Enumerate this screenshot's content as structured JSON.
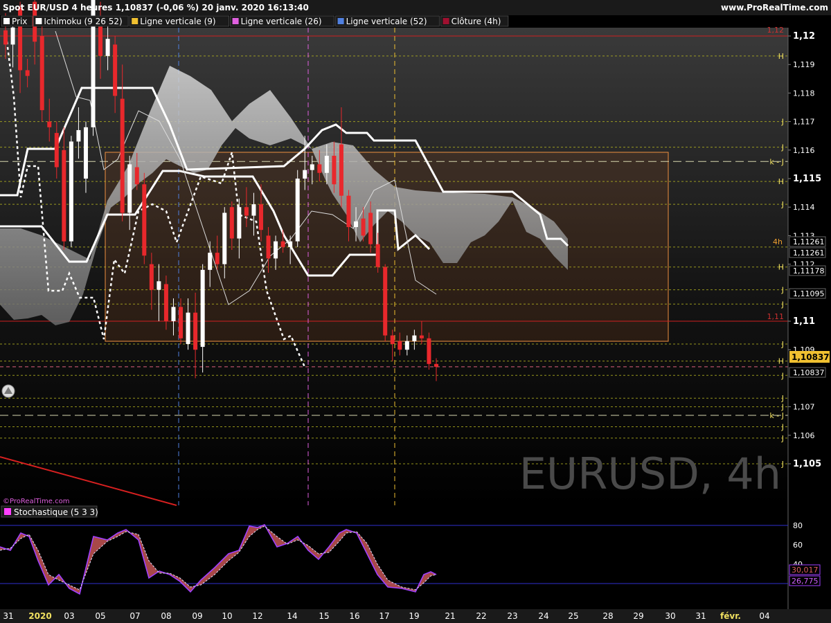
{
  "header": {
    "title": "Spot EUR/USD 4 heures 1,10837 (-0,06 %) 20 janv. 2020 16:13:40",
    "site": "www.ProRealTime.com"
  },
  "legend": [
    {
      "label": "Prix",
      "color": "#ffffff"
    },
    {
      "label": "Ichimoku (9 26 52)",
      "color": "#ffffff"
    },
    {
      "label": "Ligne verticale (9)",
      "color": "#f0c030"
    },
    {
      "label": "Ligne verticale (26)",
      "color": "#e060e0"
    },
    {
      "label": "Ligne verticale (52)",
      "color": "#5080e0"
    },
    {
      "label": "Clôture (4h)",
      "color": "#a01030"
    }
  ],
  "watermark": "EURUSD, 4h",
  "brand": "©ProRealTime.com",
  "stoch": {
    "label": "Stochastique (5 3 3)",
    "k_value": "30,017",
    "d_value": "26,775",
    "ticks": [
      "80",
      "60",
      "40"
    ]
  },
  "price_labels": {
    "last": "1,10837",
    "last2": "1,10837",
    "v1": "1,11261",
    "v2": "1,11261",
    "v3": "1,11178",
    "v4": "1,11095",
    "red_112": "1,12",
    "red_111": "1,11",
    "tf_4h": "4h"
  },
  "hj_markers": [
    {
      "y": 1.1193,
      "t": "H"
    },
    {
      "y": 1.117,
      "t": "J"
    },
    {
      "y": 1.1161,
      "t": "J"
    },
    {
      "y": 1.1156,
      "t": "k - J"
    },
    {
      "y": 1.1149,
      "t": "H"
    },
    {
      "y": 1.1141,
      "t": "J"
    },
    {
      "y": 1.1119,
      "t": "H"
    },
    {
      "y": 1.1111,
      "t": "J"
    },
    {
      "y": 1.1106,
      "t": "J"
    },
    {
      "y": 1.1092,
      "t": "J"
    },
    {
      "y": 1.1086,
      "t": "H"
    },
    {
      "y": 1.1081,
      "t": "J"
    },
    {
      "y": 1.1073,
      "t": "J"
    },
    {
      "y": 1.107,
      "t": "J"
    },
    {
      "y": 1.1067,
      "t": "k - J"
    },
    {
      "y": 1.1063,
      "t": "J"
    },
    {
      "y": 1.1059,
      "t": "J"
    },
    {
      "y": 1.105,
      "t": "J"
    }
  ],
  "colors": {
    "bull": "#ffffff",
    "bear": "#e8282c",
    "hline": "#b8b820",
    "stoch_k": "#a040ff",
    "stoch_fill": "#e06060"
  },
  "chart_data": {
    "type": "candlestick",
    "y_axis_ticks": [
      "1,12",
      "1,119",
      "1,118",
      "1,117",
      "1,116",
      "1,115",
      "1,114",
      "1,113",
      "1,112",
      "1,11",
      "1,109",
      "1,107",
      "1,106",
      "1,105"
    ],
    "ylim": [
      1.1035,
      1.1205
    ],
    "x_axis_labels": [
      "31",
      "2020",
      "03",
      "05",
      "07",
      "08",
      "09",
      "10",
      "12",
      "14",
      "15",
      "16",
      "17",
      "19",
      "21",
      "22",
      "23",
      "24",
      "25",
      "28",
      "29",
      "30",
      "31",
      "févr.",
      "04"
    ],
    "dotted_levels": [
      1.1193,
      1.117,
      1.1161,
      1.1149,
      1.1141,
      1.1126,
      1.1119,
      1.1111,
      1.1106,
      1.1092,
      1.1086,
      1.1081,
      1.1073,
      1.107,
      1.1063,
      1.1059,
      1.105
    ],
    "dashed_levels": [
      1.1156,
      1.1067
    ],
    "red_levels": [
      1.12,
      1.11
    ],
    "pink_dashed_level": 1.1084,
    "candles": [
      {
        "o": 1.1202,
        "h": 1.1208,
        "l": 1.1192,
        "c": 1.1197
      },
      {
        "o": 1.1197,
        "h": 1.1206,
        "l": 1.1189,
        "c": 1.1203
      },
      {
        "o": 1.121,
        "h": 1.1212,
        "l": 1.118,
        "c": 1.1188
      },
      {
        "o": 1.1188,
        "h": 1.1192,
        "l": 1.1182,
        "c": 1.1186
      },
      {
        "o": 1.1212,
        "h": 1.1215,
        "l": 1.119,
        "c": 1.1198
      },
      {
        "o": 1.12,
        "h": 1.1205,
        "l": 1.117,
        "c": 1.1174
      },
      {
        "o": 1.117,
        "h": 1.1178,
        "l": 1.1163,
        "c": 1.1168
      },
      {
        "o": 1.1166,
        "h": 1.117,
        "l": 1.115,
        "c": 1.1154
      },
      {
        "o": 1.116,
        "h": 1.1168,
        "l": 1.1125,
        "c": 1.1128
      },
      {
        "o": 1.1128,
        "h": 1.1165,
        "l": 1.1126,
        "c": 1.1163
      },
      {
        "o": 1.1163,
        "h": 1.1175,
        "l": 1.1157,
        "c": 1.1167
      },
      {
        "o": 1.115,
        "h": 1.117,
        "l": 1.1145,
        "c": 1.1168
      },
      {
        "o": 1.1168,
        "h": 1.1222,
        "l": 1.1165,
        "c": 1.1215
      },
      {
        "o": 1.1205,
        "h": 1.1212,
        "l": 1.1185,
        "c": 1.1193
      },
      {
        "o": 1.1193,
        "h": 1.1205,
        "l": 1.1188,
        "c": 1.1199
      },
      {
        "o": 1.1197,
        "h": 1.12,
        "l": 1.1173,
        "c": 1.1179
      },
      {
        "o": 1.1178,
        "h": 1.119,
        "l": 1.1135,
        "c": 1.1138
      },
      {
        "o": 1.1138,
        "h": 1.1158,
        "l": 1.1132,
        "c": 1.1155
      },
      {
        "o": 1.1154,
        "h": 1.1159,
        "l": 1.1146,
        "c": 1.1148
      },
      {
        "o": 1.1148,
        "h": 1.1152,
        "l": 1.112,
        "c": 1.1123
      },
      {
        "o": 1.112,
        "h": 1.1124,
        "l": 1.1104,
        "c": 1.1111
      },
      {
        "o": 1.1111,
        "h": 1.112,
        "l": 1.11,
        "c": 1.1114
      },
      {
        "o": 1.1113,
        "h": 1.1116,
        "l": 1.1097,
        "c": 1.11
      },
      {
        "o": 1.11,
        "h": 1.1108,
        "l": 1.1095,
        "c": 1.1105
      },
      {
        "o": 1.1105,
        "h": 1.1108,
        "l": 1.1092,
        "c": 1.1094
      },
      {
        "o": 1.1092,
        "h": 1.1108,
        "l": 1.109,
        "c": 1.1103
      },
      {
        "o": 1.1103,
        "h": 1.111,
        "l": 1.108,
        "c": 1.109
      },
      {
        "o": 1.1091,
        "h": 1.112,
        "l": 1.1082,
        "c": 1.1118
      },
      {
        "o": 1.1118,
        "h": 1.1128,
        "l": 1.1112,
        "c": 1.1124
      },
      {
        "o": 1.1124,
        "h": 1.113,
        "l": 1.1118,
        "c": 1.112
      },
      {
        "o": 1.112,
        "h": 1.114,
        "l": 1.1115,
        "c": 1.1138
      },
      {
        "o": 1.114,
        "h": 1.1142,
        "l": 1.1125,
        "c": 1.1129
      },
      {
        "o": 1.1129,
        "h": 1.1143,
        "l": 1.1122,
        "c": 1.114
      },
      {
        "o": 1.114,
        "h": 1.1147,
        "l": 1.1133,
        "c": 1.1137
      },
      {
        "o": 1.1137,
        "h": 1.1145,
        "l": 1.113,
        "c": 1.1141
      },
      {
        "o": 1.1141,
        "h": 1.1148,
        "l": 1.1128,
        "c": 1.1132
      },
      {
        "o": 1.113,
        "h": 1.1133,
        "l": 1.1117,
        "c": 1.1122
      },
      {
        "o": 1.1122,
        "h": 1.113,
        "l": 1.1118,
        "c": 1.1128
      },
      {
        "o": 1.1128,
        "h": 1.1132,
        "l": 1.1124,
        "c": 1.1126
      },
      {
        "o": 1.1126,
        "h": 1.113,
        "l": 1.112,
        "c": 1.1128
      },
      {
        "o": 1.1128,
        "h": 1.1153,
        "l": 1.1126,
        "c": 1.115
      },
      {
        "o": 1.115,
        "h": 1.1165,
        "l": 1.1146,
        "c": 1.1153
      },
      {
        "o": 1.1153,
        "h": 1.1158,
        "l": 1.1148,
        "c": 1.1155
      },
      {
        "o": 1.1155,
        "h": 1.116,
        "l": 1.1149,
        "c": 1.1152
      },
      {
        "o": 1.1152,
        "h": 1.1162,
        "l": 1.1148,
        "c": 1.1158
      },
      {
        "o": 1.1158,
        "h": 1.1163,
        "l": 1.1145,
        "c": 1.1148
      },
      {
        "o": 1.1162,
        "h": 1.1175,
        "l": 1.114,
        "c": 1.1144
      },
      {
        "o": 1.1144,
        "h": 1.1146,
        "l": 1.1128,
        "c": 1.1133
      },
      {
        "o": 1.1133,
        "h": 1.114,
        "l": 1.1128,
        "c": 1.1135
      },
      {
        "o": 1.1136,
        "h": 1.114,
        "l": 1.1128,
        "c": 1.113
      },
      {
        "o": 1.1138,
        "h": 1.1142,
        "l": 1.1124,
        "c": 1.1127
      },
      {
        "o": 1.1127,
        "h": 1.1131,
        "l": 1.1117,
        "c": 1.1119
      },
      {
        "o": 1.1119,
        "h": 1.112,
        "l": 1.1093,
        "c": 1.1095
      },
      {
        "o": 1.1095,
        "h": 1.1097,
        "l": 1.1086,
        "c": 1.1092
      },
      {
        "o": 1.1093,
        "h": 1.1096,
        "l": 1.1088,
        "c": 1.109
      },
      {
        "o": 1.109,
        "h": 1.1095,
        "l": 1.1088,
        "c": 1.1093
      },
      {
        "o": 1.1093,
        "h": 1.1097,
        "l": 1.109,
        "c": 1.1095
      },
      {
        "o": 1.1095,
        "h": 1.11,
        "l": 1.1092,
        "c": 1.1094
      },
      {
        "o": 1.1094,
        "h": 1.1096,
        "l": 1.1083,
        "c": 1.1085
      },
      {
        "o": 1.1085,
        "h": 1.1087,
        "l": 1.1079,
        "c": 1.1084
      }
    ]
  }
}
